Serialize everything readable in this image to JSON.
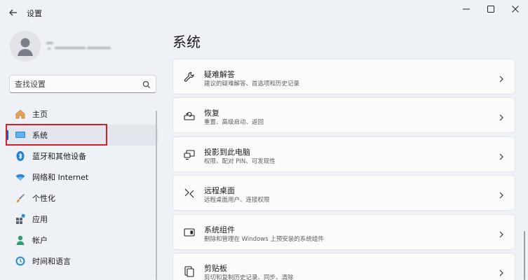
{
  "window": {
    "title": "设置",
    "minimize_icon": "minimize-icon",
    "maximize_icon": "maximize-icon",
    "close_icon": "close-icon"
  },
  "search": {
    "placeholder": "查找设置"
  },
  "sidebar": {
    "items": [
      {
        "label": "主页",
        "icon": "home-icon"
      },
      {
        "label": "系统",
        "icon": "system-monitor-icon",
        "active": true
      },
      {
        "label": "蓝牙和其他设备",
        "icon": "bluetooth-icon"
      },
      {
        "label": "网络和 Internet",
        "icon": "wifi-icon"
      },
      {
        "label": "个性化",
        "icon": "brush-icon"
      },
      {
        "label": "应用",
        "icon": "apps-icon"
      },
      {
        "label": "帐户",
        "icon": "account-icon"
      },
      {
        "label": "时间和语言",
        "icon": "clock-language-icon"
      }
    ]
  },
  "main": {
    "title": "系统",
    "cards": [
      {
        "title": "疑难解答",
        "subtitle": "建议的疑难解答、首选项和历史记录",
        "icon": "wrench-icon"
      },
      {
        "title": "恢复",
        "subtitle": "重置、高级启动、返回",
        "icon": "recovery-icon"
      },
      {
        "title": "投影到此电脑",
        "subtitle": "权限、配对 PIN、可发现性",
        "icon": "project-screen-icon"
      },
      {
        "title": "远程桌面",
        "subtitle": "远程桌面用户、连接权限",
        "icon": "remote-desktop-icon"
      },
      {
        "title": "系统组件",
        "subtitle": "删除和管理在 Windows 上预安装的系统组件",
        "icon": "system-components-icon"
      },
      {
        "title": "剪贴板",
        "subtitle": "剪切和复制历史记录、同步、清除",
        "icon": "clipboard-icon"
      }
    ]
  },
  "colors": {
    "accent": "#0067c0",
    "annotation_box": "#d0202a",
    "background": "#eef1f6",
    "card": "#fbfbfc"
  }
}
